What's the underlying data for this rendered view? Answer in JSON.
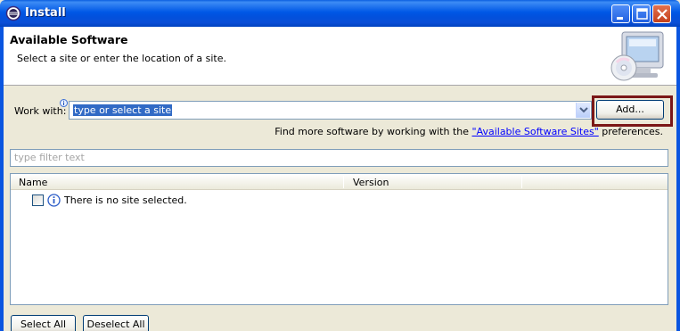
{
  "window": {
    "title": "Install",
    "accent": "#0058e6"
  },
  "banner": {
    "title": "Available Software",
    "description": "Select a site or enter the location of a site."
  },
  "work_with": {
    "label": "Work with:",
    "value": "type or select a site",
    "add_button": "Add..."
  },
  "more_software": {
    "prefix": "Find more software by working with the ",
    "link": "\"Available Software Sites\"",
    "suffix": " preferences."
  },
  "filter": {
    "placeholder": "type filter text"
  },
  "table": {
    "columns": [
      "Name",
      "Version"
    ],
    "rows": [
      {
        "checked": false,
        "icon": "info-icon",
        "text": "There is no site selected."
      }
    ]
  },
  "buttons": {
    "select_all": "Select All",
    "deselect_all": "Deselect All"
  }
}
